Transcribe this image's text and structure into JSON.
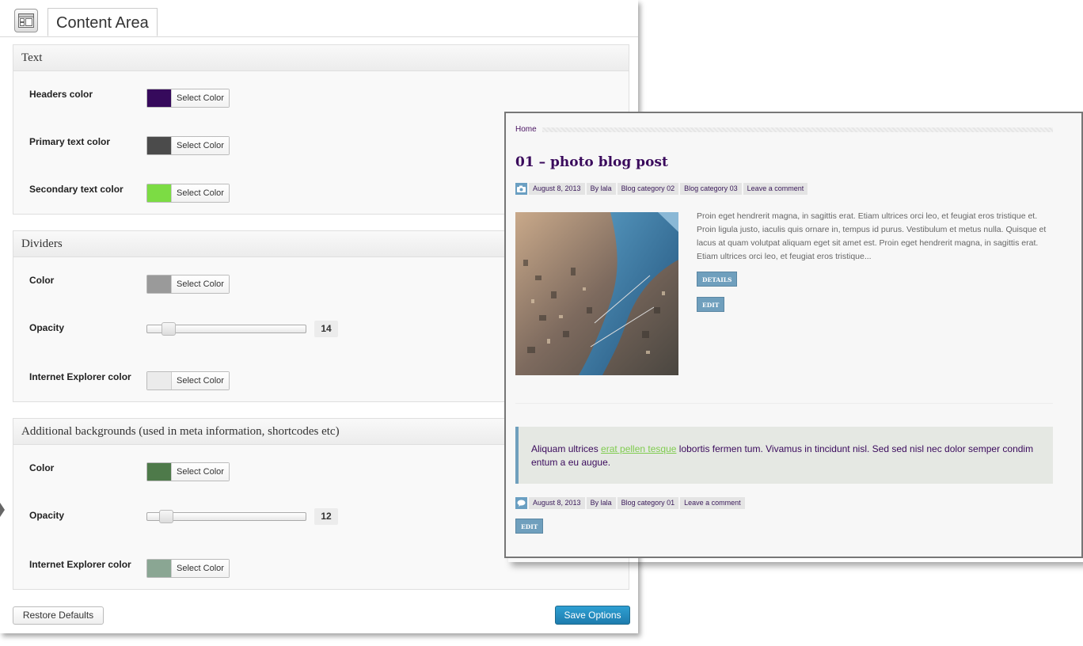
{
  "options": {
    "tab_label": "Content Area",
    "sections": {
      "text": {
        "title": "Text",
        "headers_label": "Headers color",
        "headers_color": "#360a5c",
        "primary_label": "Primary text color",
        "primary_color": "#4b4b4b",
        "secondary_label": "Secondary text color",
        "secondary_color": "#7cdc44"
      },
      "dividers": {
        "title": "Dividers",
        "color_label": "Color",
        "color": "#9a9a9a",
        "opacity_label": "Opacity",
        "opacity_value": "14",
        "opacity_percent": 14,
        "ie_label": "Internet Explorer color",
        "ie_color": "#ebebeb"
      },
      "backgrounds": {
        "title": "Additional backgrounds (used in meta information, shortcodes etc)",
        "color_label": "Color",
        "color": "#4e7a4a",
        "opacity_label": "Opacity",
        "opacity_value": "12",
        "opacity_percent": 12,
        "ie_label": "Internet Explorer color",
        "ie_color": "#8aa693"
      }
    },
    "select_color_label": "Select Color",
    "restore_label": "Restore Defaults",
    "save_label": "Save Options"
  },
  "preview": {
    "breadcrumb": "Home",
    "post_title": "01 – photo blog post",
    "meta1": [
      "August 8, 2013",
      "By lala",
      "Blog category 02",
      "Blog category 03",
      "Leave a comment"
    ],
    "excerpt": "Proin eget hendrerit magna, in sagittis erat. Etiam ultrices orci leo, et feugiat eros tristique et. Proin ligula justo, iaculis quis ornare in, tempus id purus. Vestibulum et metus nulla. Quisque et lacus at quam volutpat aliquam eget sit amet est. Proin eget hendrerit magna, in sagittis erat. Etiam ultrices orci leo, et feugiat eros tristique...",
    "details_label": "DETAILS",
    "edit_label": "EDIT",
    "quote_before": "Aliquam ultrices ",
    "quote_link": "erat pellen tesque",
    "quote_after": " lobortis fermen tum. Vivamus in tincidunt nisl. Sed sed nisl nec dolor semper condim entum a eu augue.",
    "meta2": [
      "August 8, 2013",
      "By lala",
      "Blog category 01",
      "Leave a comment"
    ],
    "edit2_label": "EDIT",
    "colors": {
      "accent_blue": "#6f9fbd",
      "title_purple": "#3a0a5c",
      "link_green": "#80cc50"
    }
  }
}
